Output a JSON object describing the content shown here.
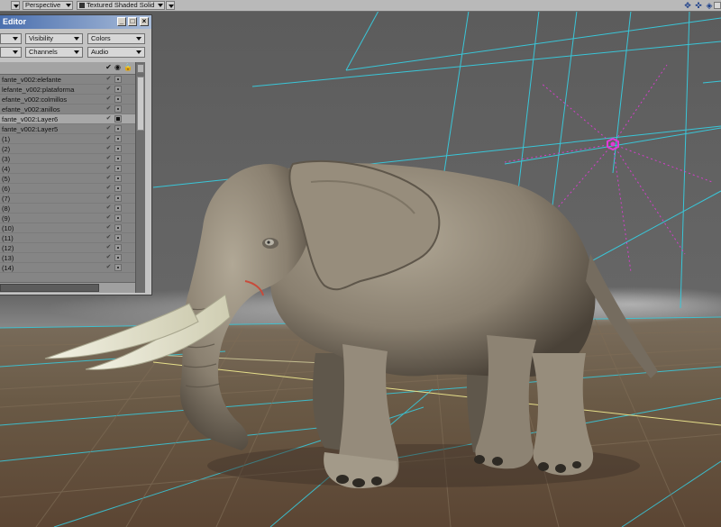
{
  "toolbar": {
    "view_mode": "Perspective",
    "render_mode": "Textured Shaded Solid"
  },
  "panel": {
    "title": "Editor",
    "close_glyph": "×",
    "dropdowns": {
      "left_top": "",
      "left_bottom": "",
      "visibility": "Visibility",
      "channels": "Channels",
      "colors": "Colors",
      "audio": "Audio"
    },
    "header_icons": [
      "check-icon",
      "eye-icon",
      "lock-icon"
    ],
    "rows": [
      {
        "label": "fante_v002:elefante",
        "checked": true,
        "selected": false
      },
      {
        "label": "lefante_v002:plataforma",
        "checked": true,
        "selected": false
      },
      {
        "label": "efante_v002:colmillos",
        "checked": true,
        "selected": false
      },
      {
        "label": "efante_v002:anillos",
        "checked": true,
        "selected": false
      },
      {
        "label": "fante_v002:Layer6",
        "checked": true,
        "selected": true
      },
      {
        "label": "fante_v002:Layer5",
        "checked": true,
        "selected": false
      },
      {
        "label": "(1)",
        "checked": true,
        "selected": false
      },
      {
        "label": "(2)",
        "checked": true,
        "selected": false
      },
      {
        "label": "(3)",
        "checked": true,
        "selected": false
      },
      {
        "label": "(4)",
        "checked": true,
        "selected": false
      },
      {
        "label": "(5)",
        "checked": true,
        "selected": false
      },
      {
        "label": "(6)",
        "checked": true,
        "selected": false
      },
      {
        "label": "(7)",
        "checked": true,
        "selected": false
      },
      {
        "label": "(8)",
        "checked": true,
        "selected": false
      },
      {
        "label": "(9)",
        "checked": true,
        "selected": false
      },
      {
        "label": "(10)",
        "checked": true,
        "selected": false
      },
      {
        "label": "(11)",
        "checked": true,
        "selected": false
      },
      {
        "label": "(12)",
        "checked": true,
        "selected": false
      },
      {
        "label": "(13)",
        "checked": true,
        "selected": false
      },
      {
        "label": "(14)",
        "checked": true,
        "selected": false
      }
    ]
  },
  "colors": {
    "viewport_bg": "#5a5a5a",
    "grid_cyan": "#39c6d8",
    "floor": "#6b5642",
    "elephant": "#8a8070",
    "tusk": "#e4e2cc",
    "light_magenta": "#e03bd6"
  }
}
